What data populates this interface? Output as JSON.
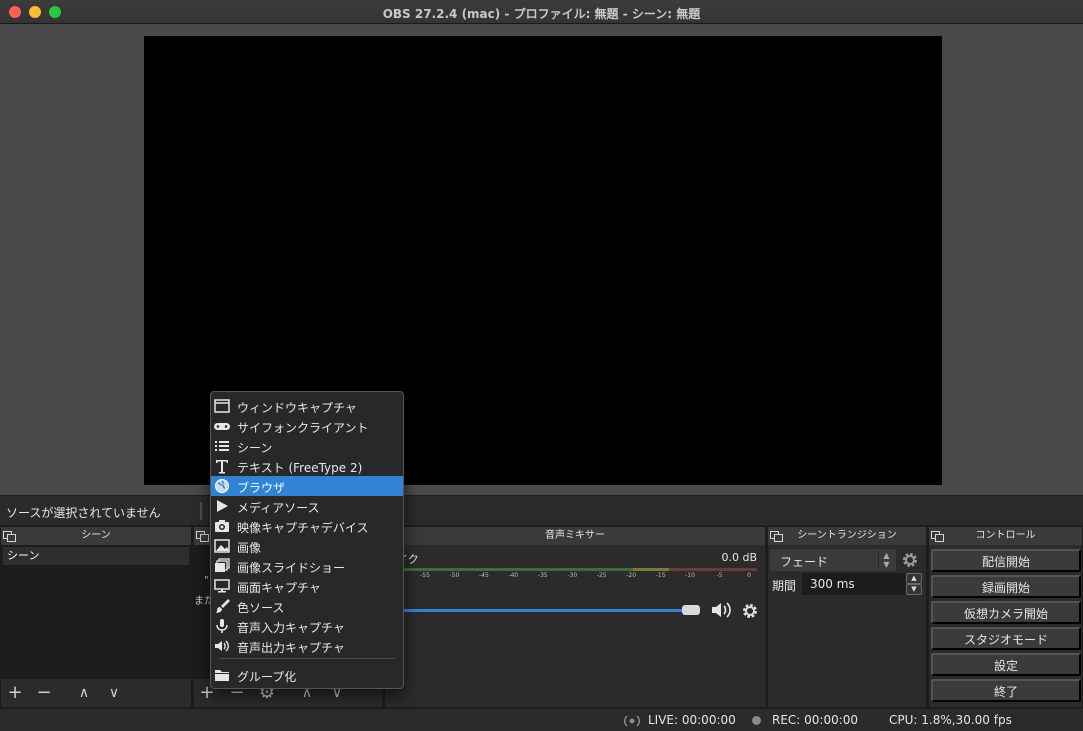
{
  "window": {
    "title": "OBS 27.2.4 (mac) - プロファイル: 無題 - シーン: 無題"
  },
  "source_toolbar": {
    "no_selection": "ソースが選択されていません"
  },
  "scenes": {
    "title": "シーン",
    "items": [
      "シーン"
    ],
    "add": "+",
    "remove": "−",
    "up": "∧",
    "down": "∨"
  },
  "sources": {
    "hint1": "\"",
    "hint2": "また",
    "add": "+",
    "remove": "−",
    "up": "∧",
    "down": "∨"
  },
  "mixer": {
    "title": "音声ミキサー",
    "channel_name": "イク",
    "channel_level": "0.0 dB",
    "ticks": [
      "-55",
      "-50",
      "-45",
      "-40",
      "-35",
      "-30",
      "-25",
      "-20",
      "-15",
      "-10",
      "-5",
      "0"
    ],
    "volume_fraction": 0.97
  },
  "transitions": {
    "title": "シーントランジション",
    "selected": "フェード",
    "duration_label": "期間",
    "duration_value": "300 ms"
  },
  "controls": {
    "title": "コントロール",
    "buttons": [
      "配信開始",
      "録画開始",
      "仮想カメラ開始",
      "スタジオモード",
      "設定",
      "終了"
    ]
  },
  "status": {
    "live": "LIVE: 00:00:00",
    "rec": "REC: 00:00:00",
    "cpu": "CPU: 1.8%,30.00 fps"
  },
  "context_menu": {
    "items": [
      {
        "label": "ウィンドウキャプチャ",
        "icon": "window-icon"
      },
      {
        "label": "サイフォンクライアント",
        "icon": "gamepad-icon"
      },
      {
        "label": "シーン",
        "icon": "list-icon"
      },
      {
        "label": "テキスト (FreeType 2)",
        "icon": "text-icon"
      },
      {
        "label": "ブラウザ",
        "icon": "globe-icon",
        "selected": true
      },
      {
        "label": "メディアソース",
        "icon": "play-icon"
      },
      {
        "label": "映像キャプチャデバイス",
        "icon": "camera-icon"
      },
      {
        "label": "画像",
        "icon": "image-icon"
      },
      {
        "label": "画像スライドショー",
        "icon": "slideshow-icon"
      },
      {
        "label": "画面キャプチャ",
        "icon": "monitor-icon"
      },
      {
        "label": "色ソース",
        "icon": "brush-icon"
      },
      {
        "label": "音声入力キャプチャ",
        "icon": "microphone-icon"
      },
      {
        "label": "音声出力キャプチャ",
        "icon": "speaker-icon"
      }
    ],
    "group": {
      "label": "グループ化",
      "icon": "folder-icon"
    }
  },
  "colors": {
    "accent": "#2f84d8",
    "dock_bg": "#2b2b2b",
    "preview_bg": "#4a4a4a"
  }
}
